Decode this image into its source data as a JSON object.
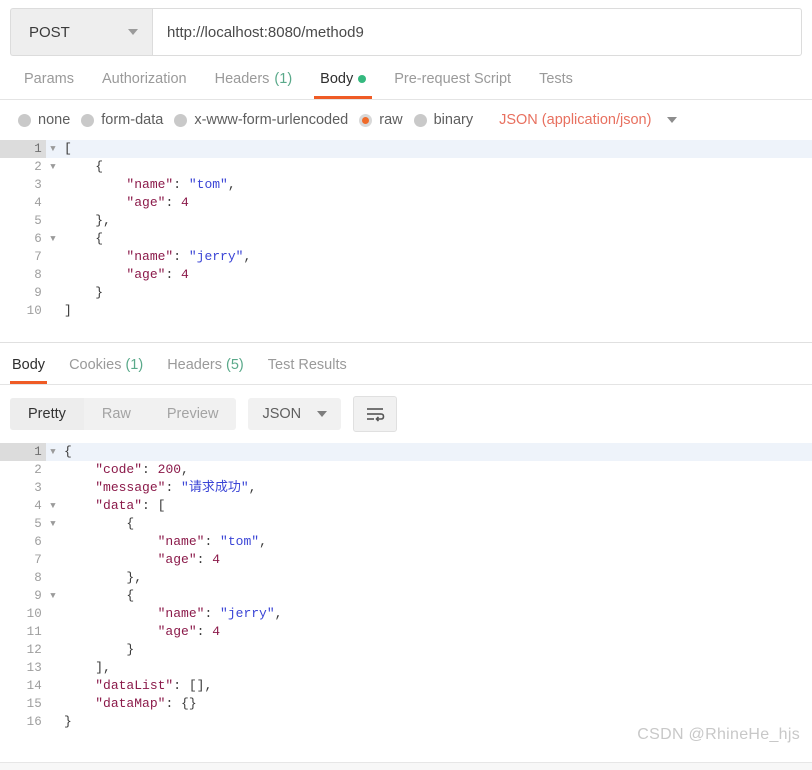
{
  "request": {
    "method": "POST",
    "url": "http://localhost:8080/method9",
    "tabs": [
      {
        "label": "Params",
        "count": "",
        "active": false,
        "dot": false
      },
      {
        "label": "Authorization",
        "count": "",
        "active": false,
        "dot": false
      },
      {
        "label": "Headers",
        "count": "(1)",
        "active": false,
        "dot": false
      },
      {
        "label": "Body",
        "count": "",
        "active": true,
        "dot": true
      },
      {
        "label": "Pre-request Script",
        "count": "",
        "active": false,
        "dot": false
      },
      {
        "label": "Tests",
        "count": "",
        "active": false,
        "dot": false
      }
    ],
    "body_types": [
      {
        "label": "none",
        "selected": false
      },
      {
        "label": "form-data",
        "selected": false
      },
      {
        "label": "x-www-form-urlencoded",
        "selected": false
      },
      {
        "label": "raw",
        "selected": true
      },
      {
        "label": "binary",
        "selected": false
      }
    ],
    "content_type": "JSON (application/json)",
    "code_lines": [
      {
        "n": "1",
        "fold": true,
        "active": true,
        "tokens": [
          {
            "t": "[",
            "c": "punc"
          }
        ]
      },
      {
        "n": "2",
        "fold": true,
        "active": false,
        "tokens": [
          {
            "t": "    {",
            "c": "punc"
          }
        ]
      },
      {
        "n": "3",
        "fold": false,
        "active": false,
        "tokens": [
          {
            "t": "        ",
            "c": "punc"
          },
          {
            "t": "\"name\"",
            "c": "key"
          },
          {
            "t": ": ",
            "c": "punc"
          },
          {
            "t": "\"tom\"",
            "c": "str"
          },
          {
            "t": ",",
            "c": "punc"
          }
        ]
      },
      {
        "n": "4",
        "fold": false,
        "active": false,
        "tokens": [
          {
            "t": "        ",
            "c": "punc"
          },
          {
            "t": "\"age\"",
            "c": "key"
          },
          {
            "t": ": ",
            "c": "punc"
          },
          {
            "t": "4",
            "c": "num"
          }
        ]
      },
      {
        "n": "5",
        "fold": false,
        "active": false,
        "tokens": [
          {
            "t": "    },",
            "c": "punc"
          }
        ]
      },
      {
        "n": "6",
        "fold": true,
        "active": false,
        "tokens": [
          {
            "t": "    {",
            "c": "punc"
          }
        ]
      },
      {
        "n": "7",
        "fold": false,
        "active": false,
        "tokens": [
          {
            "t": "        ",
            "c": "punc"
          },
          {
            "t": "\"name\"",
            "c": "key"
          },
          {
            "t": ": ",
            "c": "punc"
          },
          {
            "t": "\"jerry\"",
            "c": "str"
          },
          {
            "t": ",",
            "c": "punc"
          }
        ]
      },
      {
        "n": "8",
        "fold": false,
        "active": false,
        "tokens": [
          {
            "t": "        ",
            "c": "punc"
          },
          {
            "t": "\"age\"",
            "c": "key"
          },
          {
            "t": ": ",
            "c": "punc"
          },
          {
            "t": "4",
            "c": "num"
          }
        ]
      },
      {
        "n": "9",
        "fold": false,
        "active": false,
        "tokens": [
          {
            "t": "    }",
            "c": "punc"
          }
        ]
      },
      {
        "n": "10",
        "fold": false,
        "active": false,
        "tokens": [
          {
            "t": "]",
            "c": "punc"
          }
        ]
      }
    ]
  },
  "response": {
    "tabs": [
      {
        "label": "Body",
        "count": "",
        "active": true
      },
      {
        "label": "Cookies",
        "count": "(1)",
        "active": false
      },
      {
        "label": "Headers",
        "count": "(5)",
        "active": false
      },
      {
        "label": "Test Results",
        "count": "",
        "active": false
      }
    ],
    "view_modes": [
      {
        "label": "Pretty",
        "active": true
      },
      {
        "label": "Raw",
        "active": false
      },
      {
        "label": "Preview",
        "active": false
      }
    ],
    "format": "JSON",
    "wrap_icon": "word-wrap-icon",
    "code_lines": [
      {
        "n": "1",
        "fold": true,
        "active": true,
        "tokens": [
          {
            "t": "{",
            "c": "punc"
          }
        ]
      },
      {
        "n": "2",
        "fold": false,
        "active": false,
        "tokens": [
          {
            "t": "    ",
            "c": "punc"
          },
          {
            "t": "\"code\"",
            "c": "key"
          },
          {
            "t": ": ",
            "c": "punc"
          },
          {
            "t": "200",
            "c": "num"
          },
          {
            "t": ",",
            "c": "punc"
          }
        ]
      },
      {
        "n": "3",
        "fold": false,
        "active": false,
        "tokens": [
          {
            "t": "    ",
            "c": "punc"
          },
          {
            "t": "\"message\"",
            "c": "key"
          },
          {
            "t": ": ",
            "c": "punc"
          },
          {
            "t": "\"请求成功\"",
            "c": "str"
          },
          {
            "t": ",",
            "c": "punc"
          }
        ]
      },
      {
        "n": "4",
        "fold": true,
        "active": false,
        "tokens": [
          {
            "t": "    ",
            "c": "punc"
          },
          {
            "t": "\"data\"",
            "c": "key"
          },
          {
            "t": ": [",
            "c": "punc"
          }
        ]
      },
      {
        "n": "5",
        "fold": true,
        "active": false,
        "tokens": [
          {
            "t": "        {",
            "c": "punc"
          }
        ]
      },
      {
        "n": "6",
        "fold": false,
        "active": false,
        "tokens": [
          {
            "t": "            ",
            "c": "punc"
          },
          {
            "t": "\"name\"",
            "c": "key"
          },
          {
            "t": ": ",
            "c": "punc"
          },
          {
            "t": "\"tom\"",
            "c": "str"
          },
          {
            "t": ",",
            "c": "punc"
          }
        ]
      },
      {
        "n": "7",
        "fold": false,
        "active": false,
        "tokens": [
          {
            "t": "            ",
            "c": "punc"
          },
          {
            "t": "\"age\"",
            "c": "key"
          },
          {
            "t": ": ",
            "c": "punc"
          },
          {
            "t": "4",
            "c": "num"
          }
        ]
      },
      {
        "n": "8",
        "fold": false,
        "active": false,
        "tokens": [
          {
            "t": "        },",
            "c": "punc"
          }
        ]
      },
      {
        "n": "9",
        "fold": true,
        "active": false,
        "tokens": [
          {
            "t": "        {",
            "c": "punc"
          }
        ]
      },
      {
        "n": "10",
        "fold": false,
        "active": false,
        "tokens": [
          {
            "t": "            ",
            "c": "punc"
          },
          {
            "t": "\"name\"",
            "c": "key"
          },
          {
            "t": ": ",
            "c": "punc"
          },
          {
            "t": "\"jerry\"",
            "c": "str"
          },
          {
            "t": ",",
            "c": "punc"
          }
        ]
      },
      {
        "n": "11",
        "fold": false,
        "active": false,
        "tokens": [
          {
            "t": "            ",
            "c": "punc"
          },
          {
            "t": "\"age\"",
            "c": "key"
          },
          {
            "t": ": ",
            "c": "punc"
          },
          {
            "t": "4",
            "c": "num"
          }
        ]
      },
      {
        "n": "12",
        "fold": false,
        "active": false,
        "tokens": [
          {
            "t": "        }",
            "c": "punc"
          }
        ]
      },
      {
        "n": "13",
        "fold": false,
        "active": false,
        "tokens": [
          {
            "t": "    ],",
            "c": "punc"
          }
        ]
      },
      {
        "n": "14",
        "fold": false,
        "active": false,
        "tokens": [
          {
            "t": "    ",
            "c": "punc"
          },
          {
            "t": "\"dataList\"",
            "c": "key"
          },
          {
            "t": ": [],",
            "c": "punc"
          }
        ]
      },
      {
        "n": "15",
        "fold": false,
        "active": false,
        "tokens": [
          {
            "t": "    ",
            "c": "punc"
          },
          {
            "t": "\"dataMap\"",
            "c": "key"
          },
          {
            "t": ": {}",
            "c": "punc"
          }
        ]
      },
      {
        "n": "16",
        "fold": false,
        "active": false,
        "tokens": [
          {
            "t": "}",
            "c": "punc"
          }
        ]
      }
    ]
  },
  "watermark": "CSDN @RhineHe_hjs",
  "colors": {
    "accent": "#ef5b25",
    "content_type": "#e8705f",
    "count": "#5aa98a",
    "body_dot": "#35b97f"
  }
}
